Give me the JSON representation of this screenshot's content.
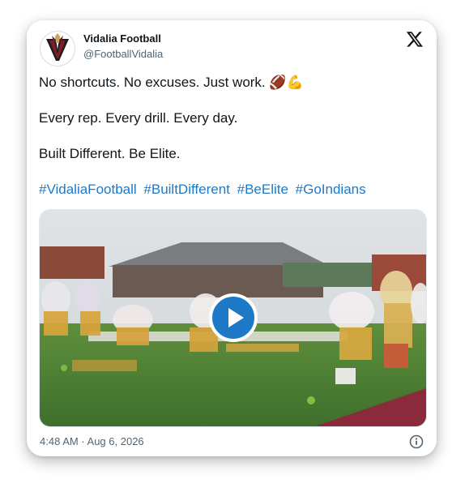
{
  "account": {
    "display_name": "Vidalia Football",
    "handle": "@FootballVidalia",
    "avatar_icon": "vidalia-v-logo-icon"
  },
  "platform_icon": "x-logo-icon",
  "post": {
    "lines": [
      "No shortcuts. No excuses. Just work. 🏈💪",
      "Every rep. Every drill. Every day.",
      "Built Different. Be Elite."
    ],
    "hashtags": [
      "#VidaliaFootball",
      "#BuiltDifferent",
      "#BeElite",
      "#GoIndians"
    ]
  },
  "media": {
    "type": "video",
    "play_icon": "play-icon"
  },
  "footer": {
    "timestamp": "4:48 AM · Aug 6, 2026",
    "info_icon": "info-icon"
  },
  "colors": {
    "hashtag": "#1d79c8",
    "play_button": "#1d79c8",
    "text": "#0f1419",
    "muted": "#536471"
  }
}
